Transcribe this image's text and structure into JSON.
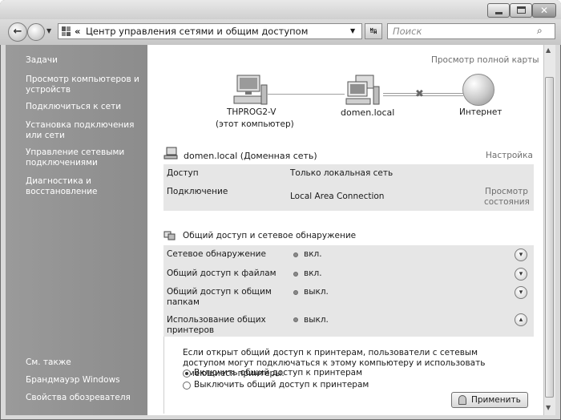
{
  "window": {
    "address_arrows": "«",
    "address_text": "Центр управления сетями и общим доступом",
    "search_placeholder": "Поиск"
  },
  "sidebar": {
    "tasks_title": "Задачи",
    "items": [
      {
        "label": "Просмотр компьютеров и устройств"
      },
      {
        "label": "Подключиться к сети"
      },
      {
        "label": "Установка подключения или сети"
      },
      {
        "label": "Управление сетевыми подключениями"
      },
      {
        "label": "Диагностика и восстановление"
      }
    ],
    "see_also_title": "См. также",
    "see_also": [
      {
        "label": "Брандмауэр Windows"
      },
      {
        "label": "Свойства обозревателя"
      }
    ]
  },
  "map": {
    "full_map_link": "Просмотр полной карты",
    "computer_name": "THPROG2-V",
    "computer_sub": "(этот компьютер)",
    "domain_name": "domen.local",
    "internet_label": "Интернет"
  },
  "network": {
    "title": "domen.local (Доменная сеть)",
    "customize": "Настройка",
    "access_label": "Доступ",
    "access_value": "Только локальная сеть",
    "connection_label": "Подключение",
    "connection_value": "Local Area Connection",
    "view_status": "Просмотр состояния"
  },
  "sharing": {
    "title": "Общий доступ и сетевое обнаружение",
    "rows": [
      {
        "label": "Сетевое обнаружение",
        "value": "вкл."
      },
      {
        "label": "Общий доступ к файлам",
        "value": "вкл."
      },
      {
        "label": "Общий доступ к общим папкам",
        "value": "выкл."
      },
      {
        "label": "Использование общих принтеров",
        "value": "выкл."
      }
    ],
    "printer_description": "Если открыт общий доступ к принтерам, пользователи с сетевым доступом могут подключаться к этому компьютеру и использовать имеющиеся принтеры.",
    "option_on": "Включить общий доступ к принтерам",
    "option_off": "Выключить общий доступ к принтерам",
    "option_selected": "on",
    "apply": "Применить"
  }
}
